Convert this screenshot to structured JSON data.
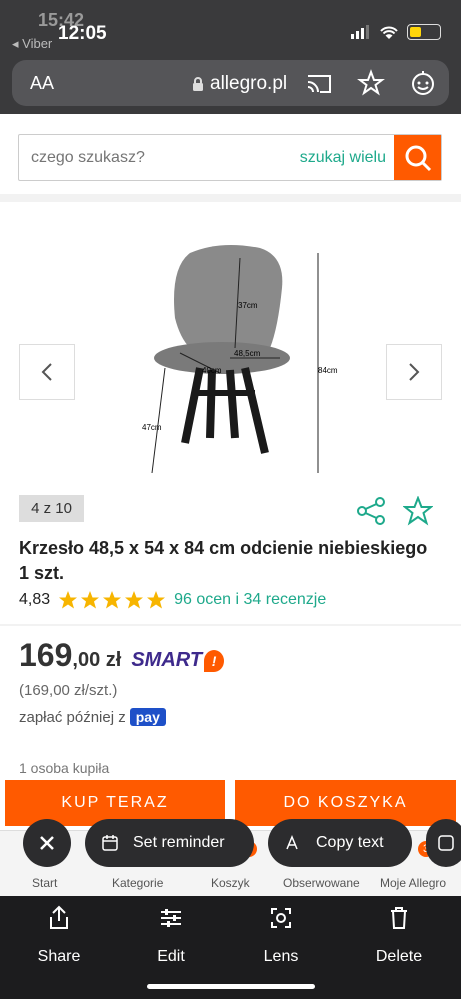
{
  "status": {
    "ghost_time": "15:42",
    "back_app": "◂ Viber",
    "time": "12:05"
  },
  "browser": {
    "aa_label": "AA",
    "domain": "allegro.pl"
  },
  "search": {
    "placeholder": "czego szukasz?",
    "extra": "szukaj wielu"
  },
  "product": {
    "counter": "4 z 10",
    "title": "Krzesło 48,5 x 54 x 84 cm odcienie niebieskiego 1 szt.",
    "rating": "4,83",
    "rating_text": "96 ocen i 34 recenzje",
    "stars": 5,
    "image_labels": {
      "h_back": "37cm",
      "w_seat": "48,5cm",
      "d_seat": "40cm",
      "h_total": "84cm",
      "h_seat": "47cm"
    }
  },
  "pricing": {
    "price_main": "169",
    "price_cents": ",00 zł",
    "smart": "SMART",
    "unit_price": "(169,00 zł/szt.)",
    "pay_later": "zapłać później z",
    "pay_logo": "pay",
    "bought": "1 osoba kupiła"
  },
  "actions": {
    "buy_now": "KUP TERAZ",
    "add_cart": "DO KOSZYKA"
  },
  "tabs": [
    {
      "label": "Start"
    },
    {
      "label": "Kategorie"
    },
    {
      "label": "Koszyk",
      "badge": "1"
    },
    {
      "label": "Obserwowane"
    },
    {
      "label": "Moje Allegro",
      "badge": "3"
    }
  ],
  "chips": {
    "reminder": "Set reminder",
    "copy": "Copy text"
  },
  "sheet": {
    "share": "Share",
    "edit": "Edit",
    "lens": "Lens",
    "delete": "Delete"
  },
  "colors": {
    "accent": "#ff5a00",
    "link": "#1ea98b",
    "star": "#f7b500"
  }
}
